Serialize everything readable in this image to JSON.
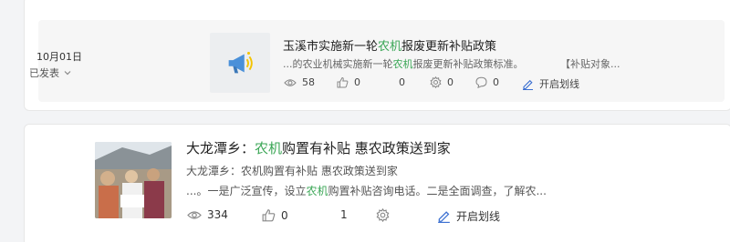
{
  "item1": {
    "date": "10月01日",
    "status": "已发表",
    "title_pre": "玉溪市实施新一轮",
    "title_hl": "农机",
    "title_post": "报废更新补贴政策",
    "summary_pre": "...的农业机械实施新一轮",
    "summary_hl": "农机",
    "summary_post": "报废更新补贴政策标准。",
    "tag": "【补贴对象...",
    "views": "58",
    "likes": "0",
    "comments_count": "0",
    "shares": "0",
    "replies": "0",
    "action_label": "开启划线",
    "thumb_icon": "megaphone-icon"
  },
  "item2": {
    "title_pre": "大龙潭乡：",
    "title_hl": "农机",
    "title_post": "购置有补贴 惠农政策送到家",
    "subtitle": "大龙潭乡：农机购置有补贴 惠农政策送到家",
    "summary_pre": "...。一是广泛宣传，设立",
    "summary_hl": "农机",
    "summary_post": "购置补贴咨询电话。二是全面调查，了解农...",
    "views": "334",
    "likes": "0",
    "count": "1",
    "action_label": "开启划线"
  },
  "colors": {
    "highlight": "#3aa655",
    "action": "#1a73e8"
  }
}
